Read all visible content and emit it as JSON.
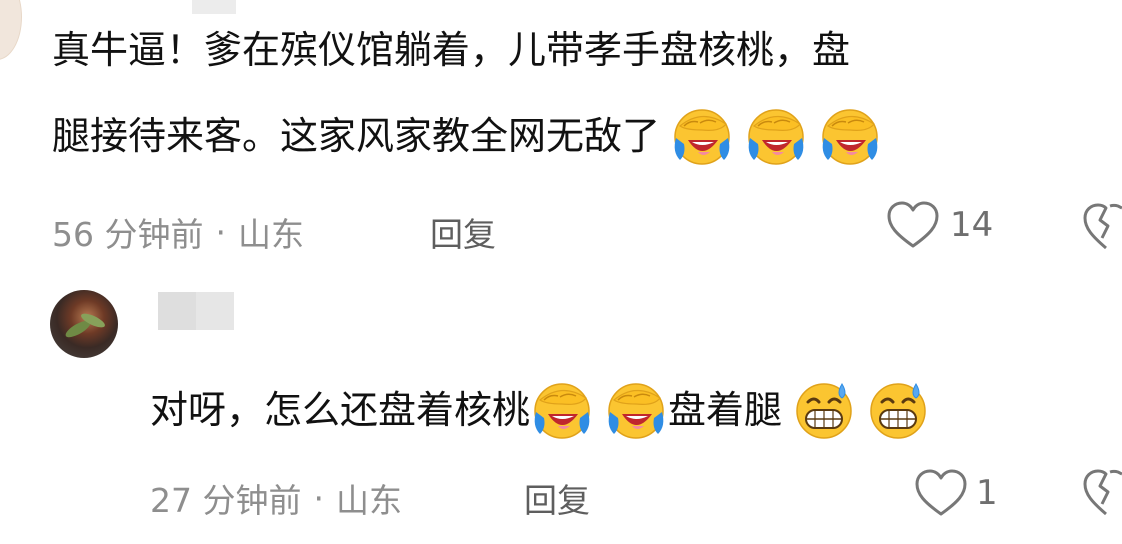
{
  "comment_1": {
    "line_1": "真牛逼！爹在殡仪馆躺着，儿带孝手盘核桃，盘",
    "line_2": "腿接待来客。这家风家教全网无敌了",
    "line_2_emojis": [
      "laughing-crying-emoji",
      "laughing-crying-emoji",
      "laughing-crying-emoji"
    ],
    "time": "56 分钟前",
    "separator": "·",
    "location": "山东",
    "reply_label": "回复",
    "like_count": "14"
  },
  "comment_2": {
    "text_part_1": "对呀，怎么还盘着核桃",
    "emojis_after_part_1": [
      "laughing-crying-emoji",
      "laughing-crying-emoji"
    ],
    "text_part_2": "盘着腿",
    "emojis_after_part_2": [
      "grinning-sweat-emoji",
      "grinning-sweat-emoji"
    ],
    "time": "27 分钟前",
    "separator": "·",
    "location": "山东",
    "reply_label": "回复",
    "like_count": "1"
  },
  "colors": {
    "text": "#111111",
    "meta": "#8e8e8e",
    "emoji_yellow": "#fbc531",
    "emoji_blue": "#2f8de4"
  }
}
